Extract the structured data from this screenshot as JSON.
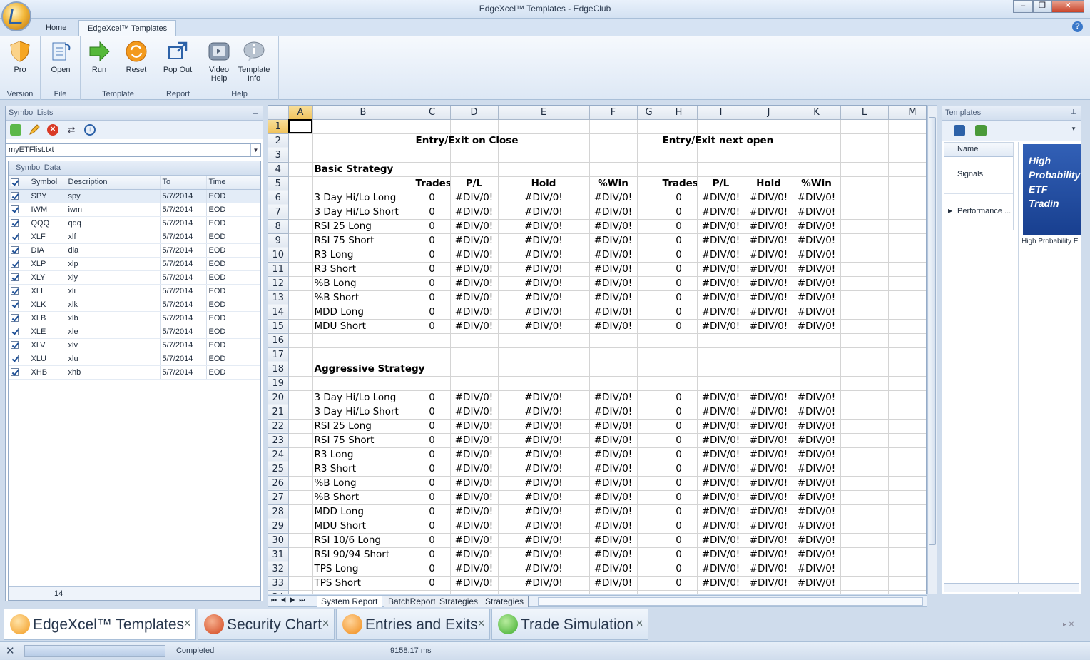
{
  "window": {
    "title": "EdgeXcel™ Templates - EdgeClub"
  },
  "ribbon_tabs": [
    "Home",
    "EdgeXcel™ Templates"
  ],
  "ribbon": {
    "groups": [
      {
        "label": "Version",
        "buttons": [
          {
            "label": "Pro",
            "icon": "shield-icon"
          }
        ]
      },
      {
        "label": "File",
        "buttons": [
          {
            "label": "Open",
            "icon": "open-file-icon"
          }
        ]
      },
      {
        "label": "Template",
        "buttons": [
          {
            "label": "Run",
            "icon": "run-arrow-icon"
          },
          {
            "label": "Reset",
            "icon": "reset-icon"
          }
        ]
      },
      {
        "label": "Report",
        "buttons": [
          {
            "label": "Pop Out",
            "icon": "pop-out-icon"
          }
        ]
      },
      {
        "label": "Help",
        "buttons": [
          {
            "label": "Video Help",
            "icon": "video-icon"
          },
          {
            "label": "Template Info",
            "icon": "info-icon"
          }
        ]
      }
    ]
  },
  "symbol_lists": {
    "title": "Symbol Lists",
    "selected_file": "myETFlist.txt",
    "data_title": "Symbol Data",
    "columns": [
      "Symbol",
      "Description",
      "To",
      "Time"
    ],
    "rows": [
      [
        "SPY",
        "spy",
        "5/7/2014",
        "EOD"
      ],
      [
        "IWM",
        "iwm",
        "5/7/2014",
        "EOD"
      ],
      [
        "QQQ",
        "qqq",
        "5/7/2014",
        "EOD"
      ],
      [
        "XLF",
        "xlf",
        "5/7/2014",
        "EOD"
      ],
      [
        "DIA",
        "dia",
        "5/7/2014",
        "EOD"
      ],
      [
        "XLP",
        "xlp",
        "5/7/2014",
        "EOD"
      ],
      [
        "XLY",
        "xly",
        "5/7/2014",
        "EOD"
      ],
      [
        "XLI",
        "xli",
        "5/7/2014",
        "EOD"
      ],
      [
        "XLK",
        "xlk",
        "5/7/2014",
        "EOD"
      ],
      [
        "XLB",
        "xlb",
        "5/7/2014",
        "EOD"
      ],
      [
        "XLE",
        "xle",
        "5/7/2014",
        "EOD"
      ],
      [
        "XLV",
        "xlv",
        "5/7/2014",
        "EOD"
      ],
      [
        "XLU",
        "xlu",
        "5/7/2014",
        "EOD"
      ],
      [
        "XHB",
        "xhb",
        "5/7/2014",
        "EOD"
      ]
    ],
    "count": "14"
  },
  "sheet": {
    "columns": [
      "A",
      "B",
      "C",
      "D",
      "E",
      "F",
      "G",
      "H",
      "I",
      "J",
      "K",
      "L",
      "M"
    ],
    "section1_left": "Entry/Exit on Close",
    "section1_right": "Entry/Exit next open",
    "basic_title": "Basic Strategy",
    "aggressive_title": "Aggressive Strategy",
    "headers": [
      "Trades",
      "P/L",
      "Hold",
      "%Win"
    ],
    "basic": [
      "3 Day Hi/Lo Long",
      "3 Day Hi/Lo Short",
      "RSI 25 Long",
      "RSI 75 Short",
      "R3 Long",
      "R3 Short",
      "%B Long",
      "%B Short",
      "MDD Long",
      "MDU Short"
    ],
    "aggressive": [
      "3 Day Hi/Lo Long",
      "3 Day Hi/Lo Short",
      "RSI 25 Long",
      "RSI 75 Short",
      "R3 Long",
      "R3 Short",
      "%B Long",
      "%B Short",
      "MDD Long",
      "MDU Short",
      "RSI 10/6 Long",
      "RSI 90/94 Short",
      "TPS Long",
      "TPS Short"
    ],
    "trades_value": "0",
    "error_value": "#DIV/0!",
    "tabs": [
      "System Report",
      "BatchReport",
      "Strategies",
      "Strategies"
    ]
  },
  "templates": {
    "title": "Templates",
    "column": "Name",
    "items": [
      "Signals",
      "Performance ..."
    ],
    "banner_text": "High Probability ETF Tradin",
    "caption": "High Probability E"
  },
  "bottom_tabs": [
    {
      "label": "EdgeXcel™ Templates",
      "color": "#f39a1d"
    },
    {
      "label": "Security Chart",
      "color": "#d1431b"
    },
    {
      "label": "Entries and Exits",
      "color": "#f08a16"
    },
    {
      "label": "Trade Simulation",
      "color": "#3cab2b"
    }
  ],
  "status": {
    "text": "Completed",
    "time": "9158.17 ms"
  }
}
